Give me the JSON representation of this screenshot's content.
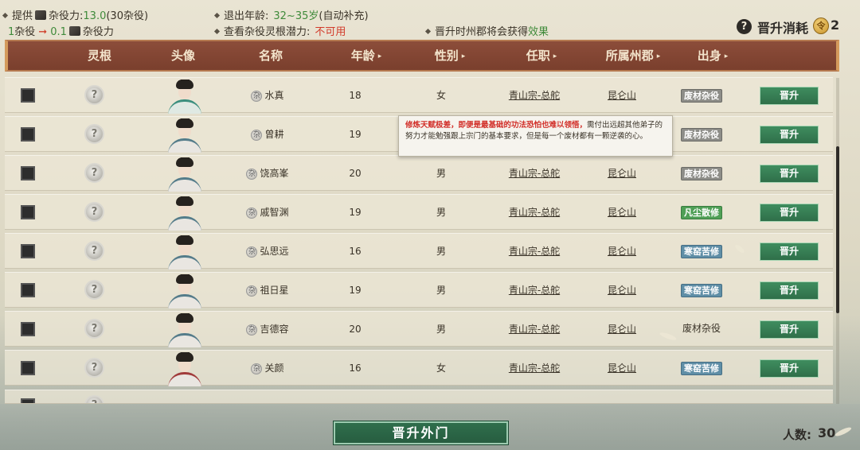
{
  "top_info": {
    "provide_label": "提供",
    "labor_label": "杂役力:",
    "labor_value": "13.0",
    "labor_count": "(30杂役)",
    "ratio_left": "1",
    "ratio_unit": "杂役",
    "ratio_value": "0.1",
    "ratio_unit2": "杂役力",
    "retire_label": "退出年龄:",
    "retire_value": "32~35岁",
    "retire_note": "(自动补充)",
    "potential_label": "查看杂役灵根潜力:",
    "potential_value": "不可用",
    "promote_hint": "晋升时州郡将会获得",
    "promote_hint_link": "效果",
    "cost_label": "晋升消耗",
    "cost_value": "2"
  },
  "table": {
    "columns": [
      "灵根",
      "头像",
      "名称",
      "年龄",
      "性别",
      "任职",
      "所属州郡",
      "出身"
    ],
    "sortable": [
      false,
      false,
      false,
      true,
      true,
      true,
      true,
      true
    ],
    "rows": [
      {
        "name": "水真",
        "age": "18",
        "gender": "女",
        "post": "青山宗-总舵",
        "region": "昆仑山",
        "origin": "废材杂役",
        "origin_type": "waste",
        "action": "晋升",
        "avatar": "f"
      },
      {
        "name": "曾耕",
        "age": "19",
        "gender": "",
        "post": "",
        "region": "",
        "origin": "废材杂役",
        "origin_type": "waste",
        "action": "晋升",
        "avatar": "m"
      },
      {
        "name": "饶高峯",
        "age": "20",
        "gender": "男",
        "post": "青山宗-总舵",
        "region": "昆仑山",
        "origin": "废材杂役",
        "origin_type": "waste",
        "action": "晋升",
        "avatar": "m"
      },
      {
        "name": "戚智渊",
        "age": "19",
        "gender": "男",
        "post": "青山宗-总舵",
        "region": "昆仑山",
        "origin": "凡尘散修",
        "origin_type": "mortal",
        "action": "晋升",
        "avatar": "m"
      },
      {
        "name": "弘思远",
        "age": "16",
        "gender": "男",
        "post": "青山宗-总舵",
        "region": "昆仑山",
        "origin": "寒窑苦修",
        "origin_type": "poor",
        "action": "晋升",
        "avatar": "m"
      },
      {
        "name": "祖日星",
        "age": "19",
        "gender": "男",
        "post": "青山宗-总舵",
        "region": "昆仑山",
        "origin": "寒窑苦修",
        "origin_type": "poor",
        "action": "晋升",
        "avatar": "m"
      },
      {
        "name": "吉德容",
        "age": "20",
        "gender": "男",
        "post": "青山宗-总舵",
        "region": "昆仑山",
        "origin": "废材杂役",
        "origin_type": "plain",
        "action": "晋升",
        "avatar": "m"
      },
      {
        "name": "关颜",
        "age": "16",
        "gender": "女",
        "post": "青山宗-总舵",
        "region": "昆仑山",
        "origin": "寒窑苦修",
        "origin_type": "poor",
        "action": "晋升",
        "avatar": "r"
      }
    ]
  },
  "tooltip": {
    "highlight": "修炼天赋极差，即便是最基础的功法恐怕也难以领悟，",
    "body": "需付出远超其他弟子的努力才能勉强跟上宗门的基本要求，但是每一个废材都有一颗逆袭的心。"
  },
  "bottom": {
    "main_button": "晋升外门",
    "count_label": "人数:",
    "count_value": "30"
  }
}
